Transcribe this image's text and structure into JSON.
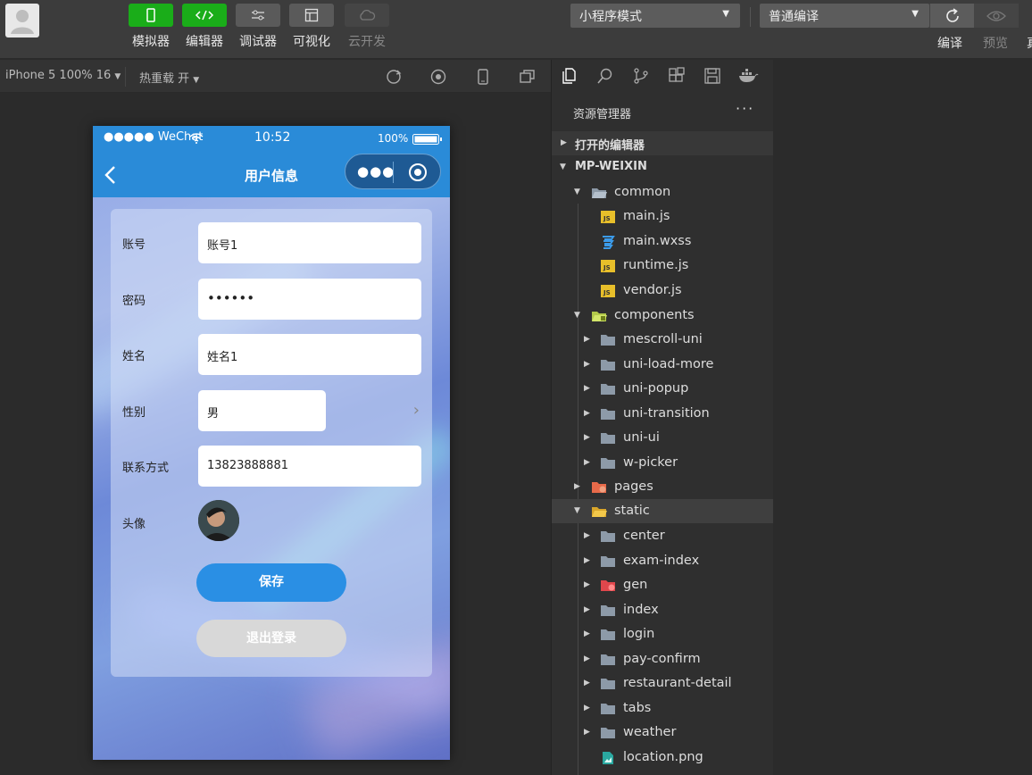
{
  "toolbar": {
    "tools": [
      {
        "label": "模拟器",
        "icon": "phone-icon"
      },
      {
        "label": "编辑器",
        "icon": "code-icon"
      },
      {
        "label": "调试器",
        "icon": "debug-icon"
      },
      {
        "label": "可视化",
        "icon": "layout-icon"
      },
      {
        "label": "云开发",
        "icon": "cloud-icon"
      }
    ],
    "mode_select": "小程序模式",
    "compile_select": "普通编译",
    "compile_label": "编译",
    "preview_label": "预览",
    "cut_label": "真"
  },
  "simbar": {
    "device": "iPhone 5 100% 16",
    "hotreload": "热重载 开"
  },
  "phone": {
    "status": {
      "carrier": "●●●●● WeChat",
      "time": "10:52",
      "battery": "100%"
    },
    "nav_title": "用户信息",
    "fields": [
      {
        "label": "账号",
        "value": "账号1"
      },
      {
        "label": "密码",
        "value": "••••••"
      },
      {
        "label": "姓名",
        "value": "姓名1"
      },
      {
        "label": "性别",
        "value": "男"
      },
      {
        "label": "联系方式",
        "value": "13823888881"
      },
      {
        "label": "头像",
        "value": ""
      }
    ],
    "save_label": "保存",
    "logout_label": "退出登录"
  },
  "explorer": {
    "title": "资源管理器",
    "more": "···",
    "sections": {
      "open_editors": "打开的编辑器",
      "project": "MP-WEIXIN"
    },
    "tree": [
      {
        "name": "common"
      },
      {
        "name": "main.js"
      },
      {
        "name": "main.wxss"
      },
      {
        "name": "runtime.js"
      },
      {
        "name": "vendor.js"
      },
      {
        "name": "components"
      },
      {
        "name": "mescroll-uni"
      },
      {
        "name": "uni-load-more"
      },
      {
        "name": "uni-popup"
      },
      {
        "name": "uni-transition"
      },
      {
        "name": "uni-ui"
      },
      {
        "name": "w-picker"
      },
      {
        "name": "pages"
      },
      {
        "name": "static"
      },
      {
        "name": "center"
      },
      {
        "name": "exam-index"
      },
      {
        "name": "gen"
      },
      {
        "name": "index"
      },
      {
        "name": "login"
      },
      {
        "name": "pay-confirm"
      },
      {
        "name": "restaurant-detail"
      },
      {
        "name": "tabs"
      },
      {
        "name": "weather"
      },
      {
        "name": "location.png"
      }
    ]
  },
  "colors": {
    "accent_green": "#1aad19",
    "phone_blue": "#2a8bd8",
    "save_blue": "#2a8fe4"
  }
}
